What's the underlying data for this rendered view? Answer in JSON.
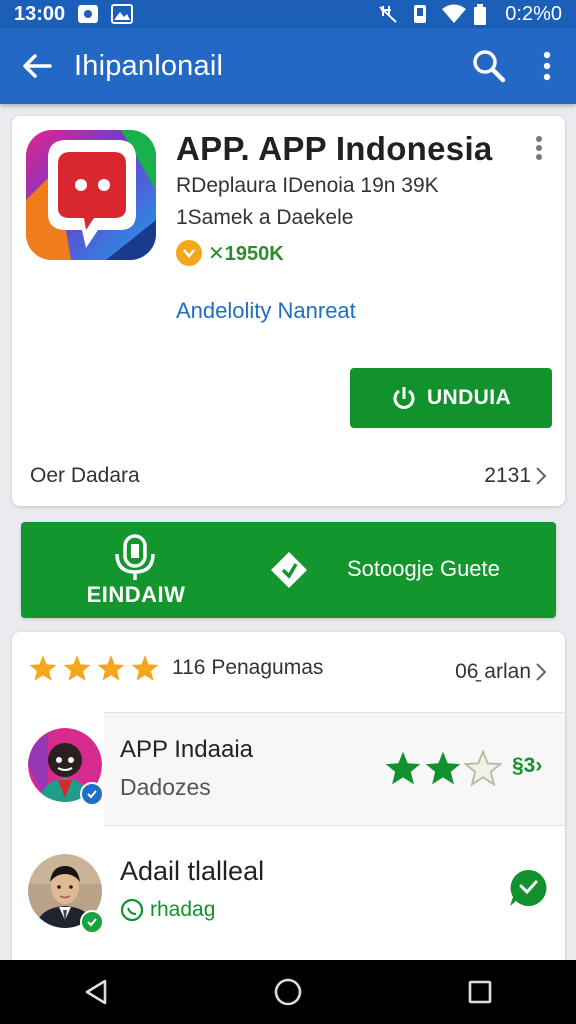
{
  "status_bar": {
    "time": "13:00",
    "battery": "0:2%0"
  },
  "app_bar": {
    "title": "Ihipanlonail"
  },
  "app": {
    "name": "APP. APP  Indonesia",
    "developer": "RDeplaura IDenoia 19n 39K",
    "category": "1Samek  a Daekele",
    "badge_count": "✕1950K",
    "link": "Andelolity Nanreat",
    "install_label": "UNDUIA",
    "footer_left": "Oer Dadara",
    "footer_right": "2131"
  },
  "banner": {
    "left_label": "EINDAIW",
    "right_label": "Sotoogje Guete"
  },
  "reviews": {
    "rating_count": "116 Penagumas",
    "right_label": "06̱ arlan",
    "items": [
      {
        "name": "APP Indaaia",
        "subtitle": "Dadozes",
        "score": "§3›"
      },
      {
        "name": "Adail tlalleal",
        "subtitle": "rhadag"
      }
    ]
  },
  "colors": {
    "primary": "#2268c4",
    "green": "#12922c",
    "star": "#f4a71d"
  }
}
